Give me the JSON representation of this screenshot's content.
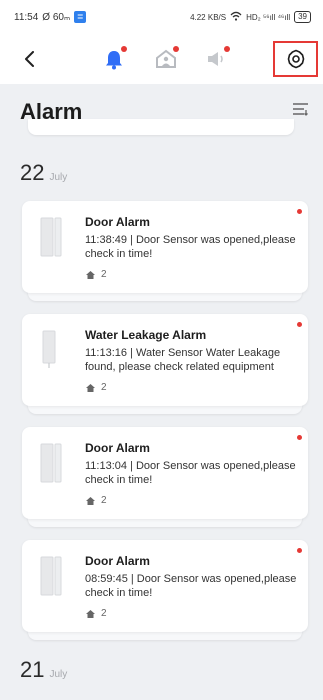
{
  "status_bar": {
    "time": "11:54",
    "left_icons": "Ø 60ₘ",
    "app_badge": "≣",
    "right_text": "4.22 KB/S",
    "network": "HD₂ ⁵⁶ıll ⁴⁶ıll",
    "battery": "39"
  },
  "toolbar": {
    "back_icon": "chevron-left-icon",
    "bell_icon": "bell-icon",
    "home_icon": "home-icon",
    "speaker_icon": "speaker-icon",
    "settings_icon": "gear-icon",
    "accent": "#e53935"
  },
  "page": {
    "title": "Alarm",
    "list_icon": "list-filter-icon"
  },
  "groups": [
    {
      "day": "22",
      "month": "July",
      "alarms": [
        {
          "title": "Door Alarm",
          "time": "11:38:49",
          "message": "11:38:49 | Door Sensor was opened,please check in time!",
          "room": "2",
          "device": "door-sensor"
        },
        {
          "title": "Water Leakage Alarm",
          "time": "11:13:16",
          "message": "11:13:16 | Water Sensor Water Leakage found, please check related equipment",
          "room": "2",
          "device": "water-sensor"
        },
        {
          "title": "Door Alarm",
          "time": "11:13:04",
          "message": "11:13:04 | Door Sensor was opened,please check in time!",
          "room": "2",
          "device": "door-sensor"
        },
        {
          "title": "Door Alarm",
          "time": "08:59:45",
          "message": "08:59:45 | Door Sensor was opened,please check in time!",
          "room": "2",
          "device": "door-sensor"
        }
      ]
    },
    {
      "day": "21",
      "month": "July",
      "alarms": []
    }
  ]
}
